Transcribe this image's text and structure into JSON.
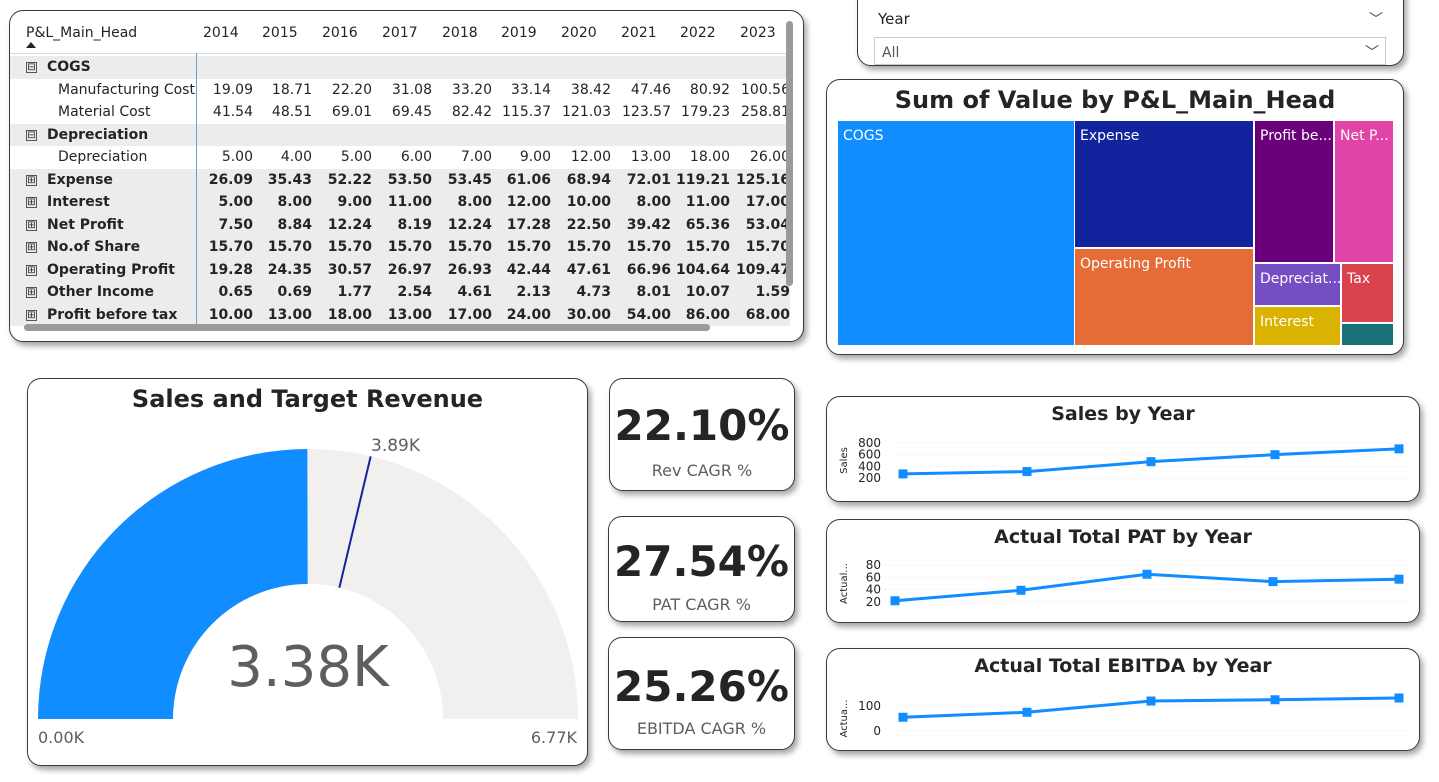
{
  "matrix": {
    "header_label": "P&L_Main_Head",
    "years": [
      "2014",
      "2015",
      "2016",
      "2017",
      "2018",
      "2019",
      "2020",
      "2021",
      "2022",
      "2023"
    ],
    "rows": [
      {
        "label": "COGS",
        "level": 0,
        "expand": "⊟",
        "bold": true,
        "values": [
          "",
          "",
          "",
          "",
          "",
          "",
          "",
          "",
          "",
          ""
        ]
      },
      {
        "label": "Manufacturing Cost",
        "level": 1,
        "expand": "",
        "bold": false,
        "values": [
          "19.09",
          "18.71",
          "22.20",
          "31.08",
          "33.20",
          "33.14",
          "38.42",
          "47.46",
          "80.92",
          "100.56"
        ]
      },
      {
        "label": "Material Cost",
        "level": 1,
        "expand": "",
        "bold": false,
        "values": [
          "41.54",
          "48.51",
          "69.01",
          "69.45",
          "82.42",
          "115.37",
          "121.03",
          "123.57",
          "179.23",
          "258.81"
        ]
      },
      {
        "label": "Depreciation",
        "level": 0,
        "expand": "⊟",
        "bold": true,
        "values": [
          "",
          "",
          "",
          "",
          "",
          "",
          "",
          "",
          "",
          ""
        ]
      },
      {
        "label": "Depreciation",
        "level": 1,
        "expand": "",
        "bold": false,
        "values": [
          "5.00",
          "4.00",
          "5.00",
          "6.00",
          "7.00",
          "9.00",
          "12.00",
          "13.00",
          "18.00",
          "26.00"
        ]
      },
      {
        "label": "Expense",
        "level": 0,
        "expand": "⊞",
        "bold": true,
        "values": [
          "26.09",
          "35.43",
          "52.22",
          "53.50",
          "53.45",
          "61.06",
          "68.94",
          "72.01",
          "119.21",
          "125.16"
        ]
      },
      {
        "label": "Interest",
        "level": 0,
        "expand": "⊞",
        "bold": true,
        "values": [
          "5.00",
          "8.00",
          "9.00",
          "11.00",
          "8.00",
          "12.00",
          "10.00",
          "8.00",
          "11.00",
          "17.00"
        ]
      },
      {
        "label": "Net Profit",
        "level": 0,
        "expand": "⊞",
        "bold": true,
        "values": [
          "7.50",
          "8.84",
          "12.24",
          "8.19",
          "12.24",
          "17.28",
          "22.50",
          "39.42",
          "65.36",
          "53.04"
        ]
      },
      {
        "label": "No.of Share",
        "level": 0,
        "expand": "⊞",
        "bold": true,
        "values": [
          "15.70",
          "15.70",
          "15.70",
          "15.70",
          "15.70",
          "15.70",
          "15.70",
          "15.70",
          "15.70",
          "15.70"
        ]
      },
      {
        "label": "Operating Profit",
        "level": 0,
        "expand": "⊞",
        "bold": true,
        "values": [
          "19.28",
          "24.35",
          "30.57",
          "26.97",
          "26.93",
          "42.44",
          "47.61",
          "66.96",
          "104.64",
          "109.47"
        ]
      },
      {
        "label": "Other Income",
        "level": 0,
        "expand": "⊞",
        "bold": true,
        "values": [
          "0.65",
          "0.69",
          "1.77",
          "2.54",
          "4.61",
          "2.13",
          "4.73",
          "8.01",
          "10.07",
          "1.59"
        ]
      },
      {
        "label": "Profit before tax",
        "level": 0,
        "expand": "⊞",
        "bold": true,
        "values": [
          "10.00",
          "13.00",
          "18.00",
          "13.00",
          "17.00",
          "24.00",
          "30.00",
          "54.00",
          "86.00",
          "68.00"
        ]
      }
    ]
  },
  "slicer": {
    "label": "Year",
    "value": "All"
  },
  "treemap": {
    "title": "Sum of Value by P&L_Main_Head",
    "tiles": [
      {
        "label": "COGS",
        "color": "#118DFF"
      },
      {
        "label": "Expense",
        "color": "#12239E"
      },
      {
        "label": "Operating Profit",
        "color": "#E66C37"
      },
      {
        "label": "Profit be...",
        "color": "#6B007B"
      },
      {
        "label": "Net P...",
        "color": "#E044A7"
      },
      {
        "label": "Depreciat...",
        "color": "#744EC2"
      },
      {
        "label": "Tax",
        "color": "#D9434E"
      },
      {
        "label": "Interest",
        "color": "#D9B300"
      },
      {
        "label": "",
        "color": "#197278"
      }
    ]
  },
  "gauge": {
    "title": "Sales and Target Revenue",
    "value_label": "3.38K",
    "min_label": "0.00K",
    "max_label": "6.77K",
    "target_label": "3.89K",
    "value": 3380,
    "min": 0,
    "max": 6770,
    "target": 3890,
    "fill_color": "#118DFF",
    "track_color": "#F1F0EF",
    "target_color": "#12239E"
  },
  "kpis": [
    {
      "value": "22.10%",
      "label": "Rev CAGR %"
    },
    {
      "value": "27.54%",
      "label": "PAT CAGR %"
    },
    {
      "value": "25.26%",
      "label": "EBITDA CAGR %"
    }
  ],
  "charts": [
    {
      "title": "Sales by Year",
      "ylabel": "Sales",
      "yticks": [
        "800",
        "600",
        "400",
        "200"
      ],
      "ytick_values": [
        800,
        600,
        400,
        200
      ],
      "ylim": [
        200,
        800
      ],
      "values": [
        270,
        310,
        480,
        600,
        700
      ],
      "color": "#118DFF"
    },
    {
      "title": "Actual Total PAT by Year",
      "ylabel": "Actual...",
      "yticks": [
        "80",
        "60",
        "40",
        "20"
      ],
      "ytick_values": [
        80,
        60,
        40,
        20
      ],
      "ylim": [
        20,
        80
      ],
      "values": [
        22,
        39,
        65,
        53,
        57
      ],
      "color": "#118DFF"
    },
    {
      "title": "Actual Total EBITDA by Year",
      "ylabel": "Actua...",
      "yticks": [
        "100",
        "0"
      ],
      "ytick_values": [
        100,
        0
      ],
      "ylim": [
        0,
        100
      ],
      "values": [
        55,
        75,
        120,
        125,
        150
      ],
      "color": "#118DFF"
    }
  ],
  "chart_data": [
    {
      "type": "line",
      "title": "Sales by Year",
      "xlabel": "",
      "ylabel": "Sales",
      "x": [
        1,
        2,
        3,
        4,
        5
      ],
      "values": [
        270,
        310,
        480,
        600,
        700
      ],
      "ylim": [
        200,
        800
      ]
    },
    {
      "type": "line",
      "title": "Actual Total PAT by Year",
      "xlabel": "",
      "ylabel": "Actual...",
      "x": [
        1,
        2,
        3,
        4,
        5
      ],
      "values": [
        22,
        39,
        65,
        53,
        57
      ],
      "ylim": [
        20,
        80
      ]
    },
    {
      "type": "line",
      "title": "Actual Total EBITDA by Year",
      "xlabel": "",
      "ylabel": "Actua...",
      "x": [
        1,
        2,
        3,
        4,
        5
      ],
      "values": [
        55,
        75,
        120,
        125,
        150
      ],
      "ylim": [
        0,
        100
      ]
    }
  ]
}
